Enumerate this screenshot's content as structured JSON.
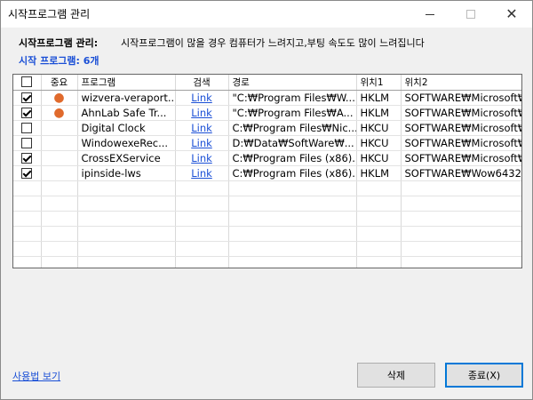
{
  "window": {
    "title": "시작프로그램 관리",
    "minimize": "—",
    "close": "✕"
  },
  "info": {
    "label": "시작프로그램 관리:",
    "text": "시작프로그램이 많을 경우 컴퓨터가 느려지고,부팅 속도도 많이 느려집니다"
  },
  "count_label": "시작 프로그램: 6개",
  "table": {
    "headers": {
      "important": "중요",
      "program": "프로그램",
      "search": "검색",
      "path": "경로",
      "loc1": "위치1",
      "loc2": "위치2"
    },
    "rows": [
      {
        "checked": true,
        "important": true,
        "program": "wizvera-veraport...",
        "search": "Link",
        "path": "\"C:₩Program Files₩W...",
        "loc1": "HKLM",
        "loc2": "SOFTWARE₩Microsoft₩"
      },
      {
        "checked": true,
        "important": true,
        "program": "AhnLab Safe Tr...",
        "search": "Link",
        "path": "\"C:₩Program Files₩A...",
        "loc1": "HKLM",
        "loc2": "SOFTWARE₩Microsoft₩"
      },
      {
        "checked": false,
        "important": false,
        "program": "Digital Clock",
        "search": "Link",
        "path": "C:₩Program Files₩Nic...",
        "loc1": "HKCU",
        "loc2": "SOFTWARE₩Microsoft₩"
      },
      {
        "checked": false,
        "important": false,
        "program": "WindowexeRec...",
        "search": "Link",
        "path": "D:₩Data₩SoftWare₩...",
        "loc1": "HKCU",
        "loc2": "SOFTWARE₩Microsoft₩"
      },
      {
        "checked": true,
        "important": false,
        "program": "CrossEXService",
        "search": "Link",
        "path": "C:₩Program Files (x86)...",
        "loc1": "HKCU",
        "loc2": "SOFTWARE₩Microsoft₩"
      },
      {
        "checked": true,
        "important": false,
        "program": "ipinside-lws",
        "search": "Link",
        "path": "C:₩Program Files (x86)...",
        "loc1": "HKLM",
        "loc2": "SOFTWARE₩Wow6432"
      }
    ],
    "empty_rows": 6,
    "important_color": "#e06a2c",
    "link_color": "#1a4fd6"
  },
  "footer": {
    "usage_link": "사용법 보기",
    "delete_button": "삭제",
    "exit_button": "종료(X)"
  }
}
